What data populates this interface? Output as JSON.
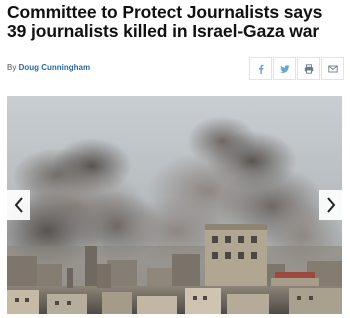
{
  "article": {
    "title": "Committee to Protect Journalists says 39 journalists killed in Israel-Gaza war",
    "byline_prefix": "By",
    "author": "Doug Cunningham"
  },
  "share": {
    "buttons": [
      {
        "icon": "facebook-icon",
        "glyph": "f"
      },
      {
        "icon": "twitter-icon"
      },
      {
        "icon": "print-icon"
      },
      {
        "icon": "email-icon"
      }
    ],
    "icon_color": "#6fa3d0"
  },
  "gallery": {
    "image": "smoke-over-gaza-city-photo",
    "prev_icon": "chevron-left-icon",
    "next_icon": "chevron-right-icon"
  },
  "colors": {
    "author_link": "#2a6aa8",
    "headline": "#111111"
  }
}
